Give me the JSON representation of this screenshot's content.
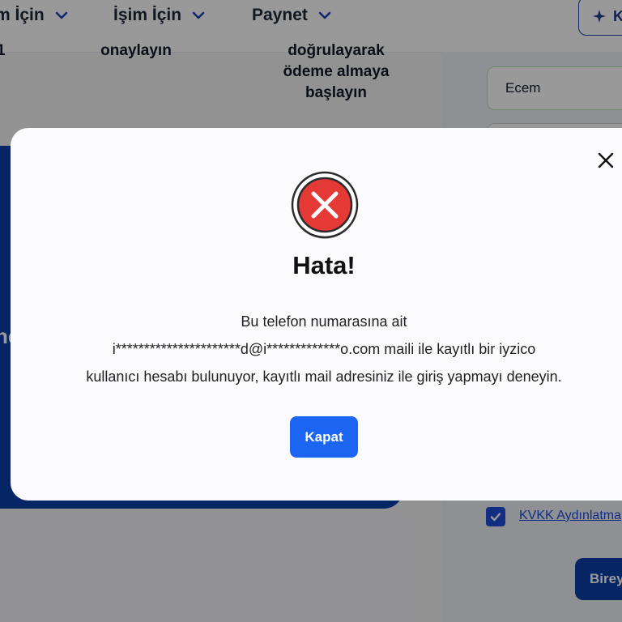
{
  "nav": {
    "items": [
      {
        "label": "m İçin"
      },
      {
        "label": "İşim İçin"
      },
      {
        "label": "Paynet"
      }
    ],
    "cta_label": "K"
  },
  "steps": {
    "step2_text": "onaylayın",
    "step3_lines": [
      "doğrulayarak",
      "ödeme almaya",
      "başlayın"
    ],
    "step1_text": "1"
  },
  "left_panel": {
    "text": "ne"
  },
  "form": {
    "name_value": "Ecem",
    "kvkk_label": "KVKK Aydınlatma",
    "submit_label": "Birey"
  },
  "modal": {
    "title": "Hata!",
    "message_lines": [
      "Bu telefon numarasına ait",
      "i**********************d@i*************o.com maili ile kayıtlı bir iyzico",
      "kullanıcı hesabı bulunuyor, kayıtlı mail adresiniz ile giriş yapmayı deneyin."
    ],
    "close_button_label": "Kapat"
  },
  "colors": {
    "primary": "#1c64f2",
    "brand_dark": "#0b3ea8",
    "error": "#e53935"
  },
  "icons": [
    "chevron-down-icon",
    "sparkle-icon",
    "close-icon",
    "error-x-icon",
    "check-icon"
  ]
}
